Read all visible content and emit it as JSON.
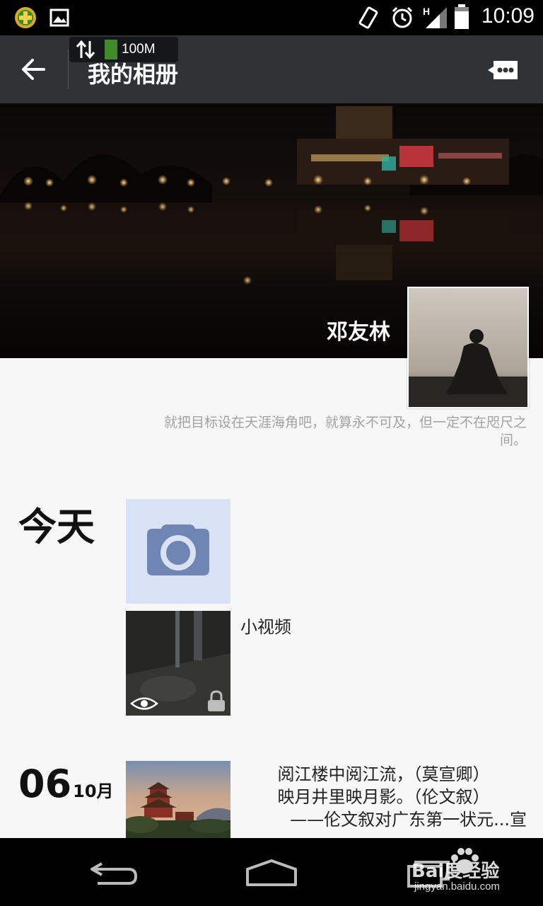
{
  "status_bar": {
    "time": "10:09",
    "signal_label": "H",
    "data_badge": "100M",
    "icons": [
      "360-security-icon",
      "image-notification-icon",
      "vibrate-icon",
      "alarm-icon",
      "signal-icon",
      "battery-icon"
    ]
  },
  "toolbar": {
    "title": "我的相册",
    "back_icon": "back-arrow-icon",
    "message_icon": "message-bubble-icon"
  },
  "profile": {
    "username": "邓友林",
    "signature": "就把目标设在天涯海角吧，就算永不可及，但一定不在咫尺之间。"
  },
  "timeline": {
    "today": {
      "date_label": "今天",
      "video_label": "小视频"
    },
    "entry2": {
      "day": "06",
      "month": "10月",
      "lines": [
        "阅江楼中阅江流，（莫宣卿）",
        "映月井里映月影。（伦文叙）",
        "——伦文叙对广东第一状元...宣"
      ]
    }
  },
  "watermark": {
    "brand": "Bai度经验",
    "url": "jingyan.baidu.com"
  },
  "colors": {
    "toolbar_bg": "#2f3336",
    "camera_tile_bg": "#d9e1f4",
    "camera_icon": "#6f86b4"
  }
}
